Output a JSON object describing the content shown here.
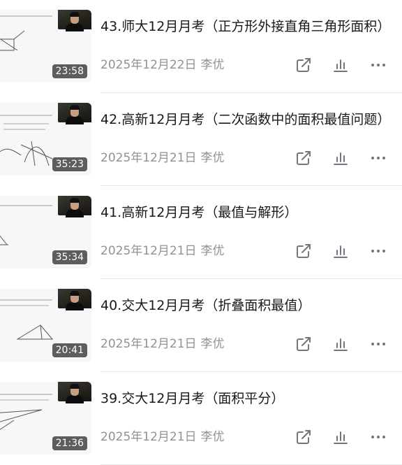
{
  "videos": [
    {
      "title": "43.师大12月月考（正方形外接直角三角形面积）",
      "date": "2025年12月22日",
      "author": "李优",
      "duration": "23:58"
    },
    {
      "title": "42.高新12月月考（二次函数中的面积最值问题）",
      "date": "2025年12月21日",
      "author": "李优",
      "duration": "35:23"
    },
    {
      "title": "41.高新12月月考（最值与解形）",
      "date": "2025年12月21日",
      "author": "李优",
      "duration": "35:34"
    },
    {
      "title": "40.交大12月月考（折叠面积最值）",
      "date": "2025年12月21日",
      "author": "李优",
      "duration": "20:41"
    },
    {
      "title": "39.交大12月月考（面积平分）",
      "date": "2025年12月21日",
      "author": "李优",
      "duration": "21:36"
    }
  ],
  "icons": {
    "share": "share-icon",
    "stats": "stats-icon",
    "more": "more-icon"
  },
  "colors": {
    "title": "#18191c",
    "meta": "#8e9297",
    "icon": "#73777d",
    "badge_bg": "#484848"
  }
}
